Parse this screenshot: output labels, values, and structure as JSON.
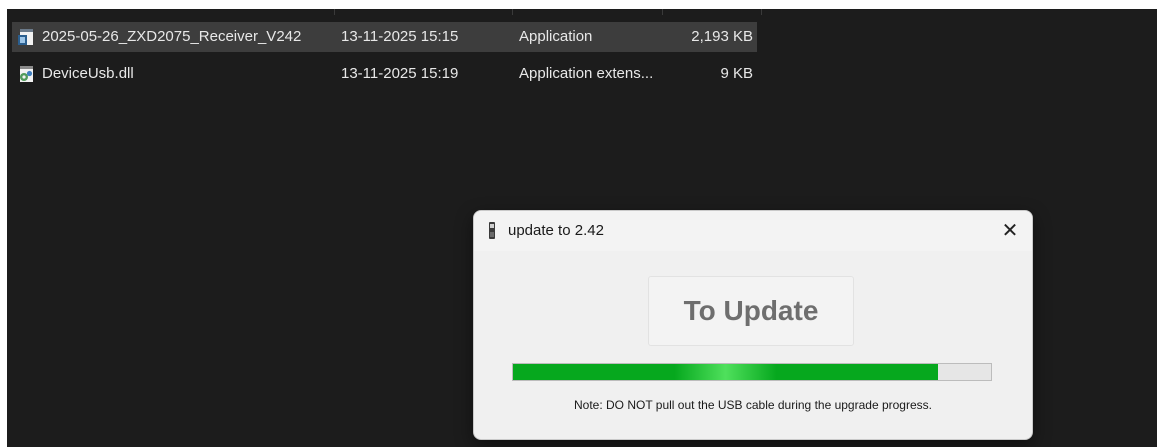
{
  "files": [
    {
      "name": "2025-05-26_ZXD2075_Receiver_V242",
      "date_modified": "13-11-2025 15:15",
      "type": "Application",
      "size": "2,193 KB",
      "selected": true,
      "icon": "application-icon"
    },
    {
      "name": "DeviceUsb.dll",
      "date_modified": "13-11-2025 15:19",
      "type": "Application extens...",
      "size": "9 KB",
      "selected": false,
      "icon": "dll-file-icon"
    }
  ],
  "dialog": {
    "title": "update to 2.42",
    "close_glyph": "✕",
    "update_button_label": "To Update",
    "progress_fraction": 0.89,
    "note": "Note: DO NOT pull out the USB cable during the upgrade progress."
  },
  "colors": {
    "explorer_bg": "#1c1c1c",
    "selected_row": "#3d3d3d",
    "progress_green": "#06a81e",
    "dialog_bg": "#f0f0f0"
  }
}
